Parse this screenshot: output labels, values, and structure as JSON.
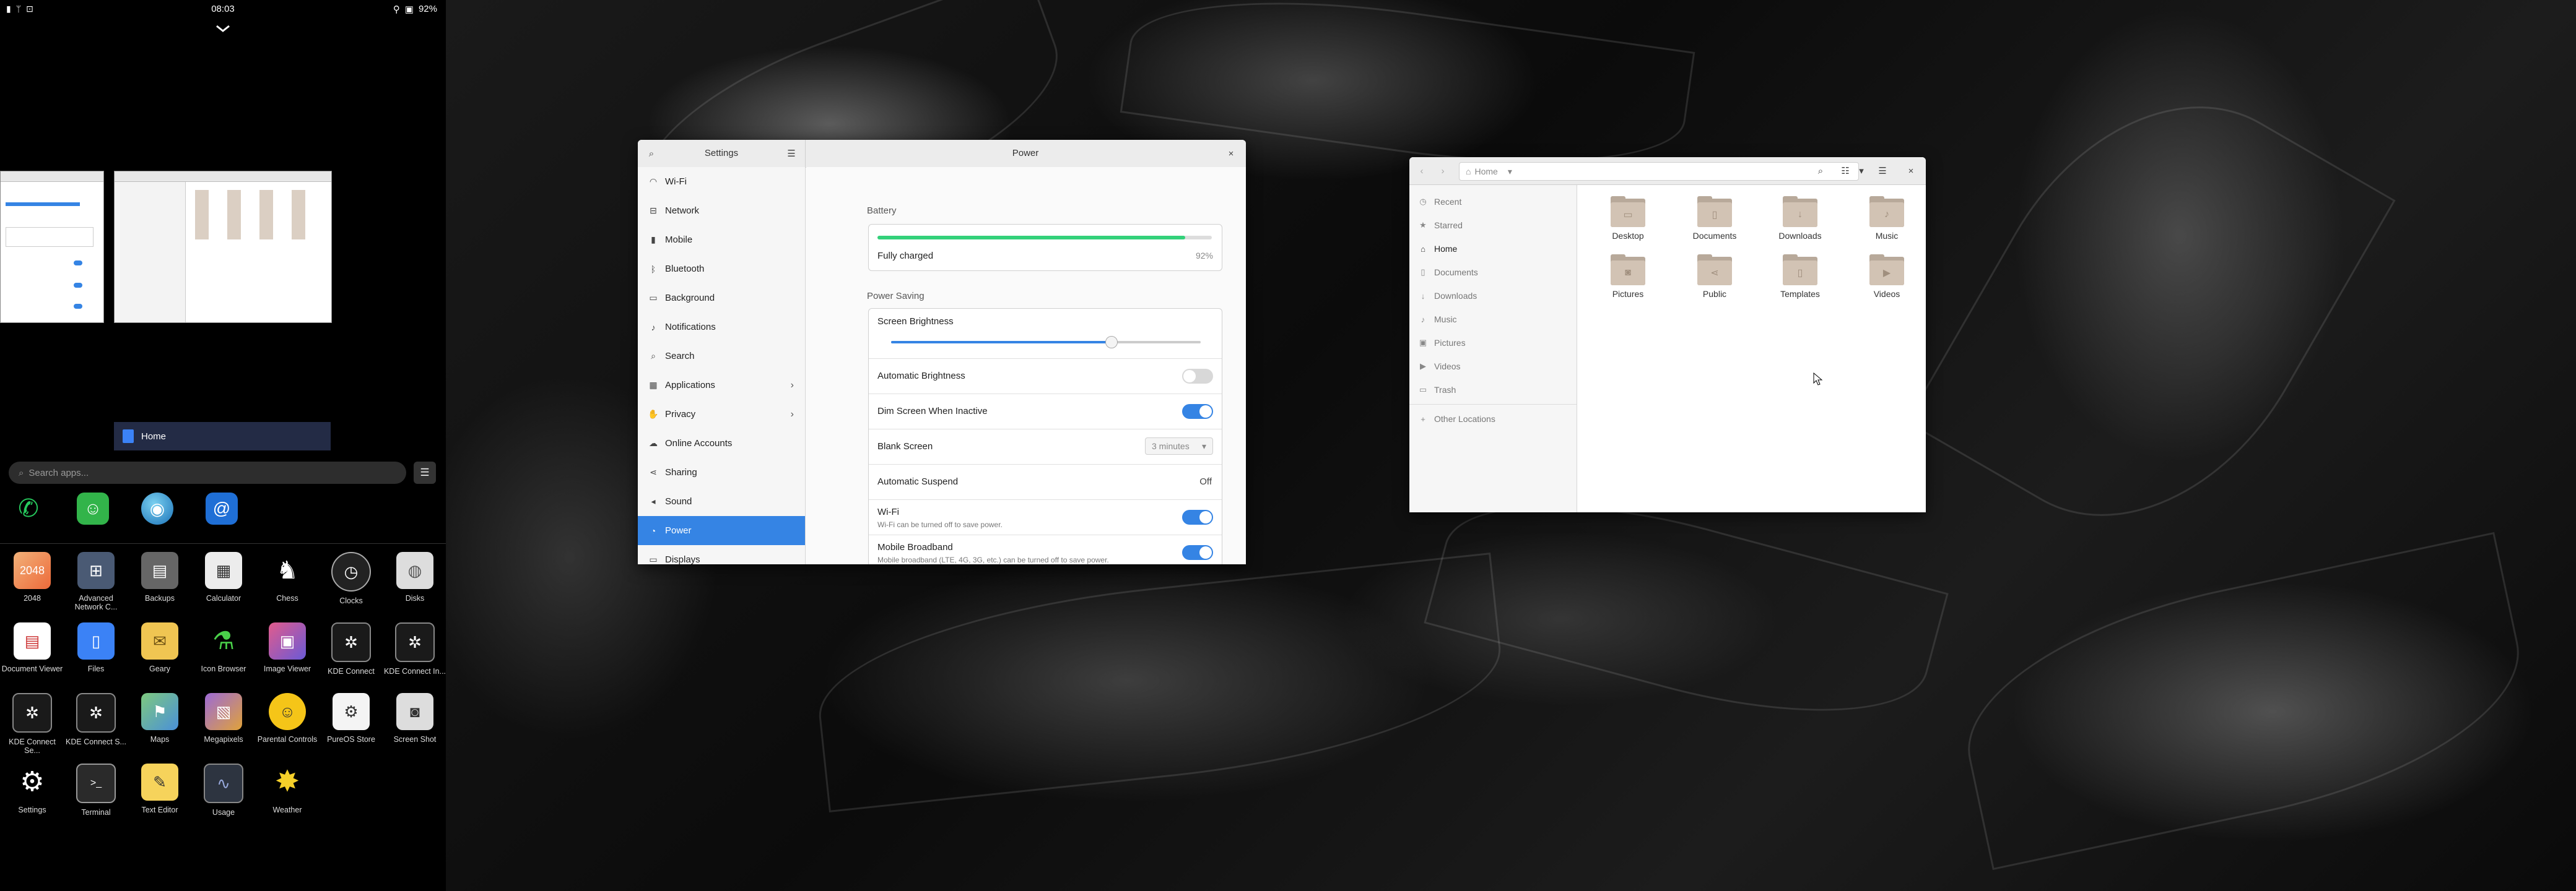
{
  "statusbar": {
    "time": "08:03",
    "battery": "92%"
  },
  "overview": {
    "active_window_title": "Home"
  },
  "app_search": {
    "placeholder": "Search apps..."
  },
  "apps": [
    {
      "label": "2048"
    },
    {
      "label": "Advanced Network C..."
    },
    {
      "label": "Backups"
    },
    {
      "label": "Calculator"
    },
    {
      "label": "Chess"
    },
    {
      "label": "Clocks"
    },
    {
      "label": "Disks"
    },
    {
      "label": "Document Viewer"
    },
    {
      "label": "Files"
    },
    {
      "label": "Geary"
    },
    {
      "label": "Icon Browser"
    },
    {
      "label": "Image Viewer"
    },
    {
      "label": "KDE Connect"
    },
    {
      "label": "KDE Connect In..."
    },
    {
      "label": "KDE Connect Se..."
    },
    {
      "label": "KDE Connect S..."
    },
    {
      "label": "Maps"
    },
    {
      "label": "Megapixels"
    },
    {
      "label": "Parental Controls"
    },
    {
      "label": "PureOS Store"
    },
    {
      "label": "Screen Shot"
    },
    {
      "label": "Settings"
    },
    {
      "label": "Terminal"
    },
    {
      "label": "Text Editor"
    },
    {
      "label": "Usage"
    },
    {
      "label": "Weather"
    }
  ],
  "settings": {
    "title": "Settings",
    "panel_title": "Power",
    "sidebar": [
      {
        "label": "Wi-Fi",
        "icon": "wifi-icon"
      },
      {
        "label": "Network",
        "icon": "network-icon"
      },
      {
        "label": "Mobile",
        "icon": "mobile-icon"
      },
      {
        "label": "Bluetooth",
        "icon": "bluetooth-icon"
      },
      {
        "label": "Background",
        "icon": "background-icon"
      },
      {
        "label": "Notifications",
        "icon": "bell-icon"
      },
      {
        "label": "Search",
        "icon": "search-icon"
      },
      {
        "label": "Applications",
        "icon": "apps-icon"
      },
      {
        "label": "Privacy",
        "icon": "hand-icon"
      },
      {
        "label": "Online Accounts",
        "icon": "cloud-icon"
      },
      {
        "label": "Sharing",
        "icon": "share-icon"
      },
      {
        "label": "Sound",
        "icon": "speaker-icon"
      },
      {
        "label": "Power",
        "icon": "power-icon"
      },
      {
        "label": "Displays",
        "icon": "display-icon"
      }
    ],
    "battery": {
      "section": "Battery",
      "status": "Fully charged",
      "percent": "92%",
      "level": 0.92
    },
    "power_saving": {
      "section": "Power Saving",
      "screen_brightness": "Screen Brightness",
      "brightness_level": 0.71,
      "automatic_brightness": "Automatic Brightness",
      "dim_screen": "Dim Screen When Inactive",
      "blank_screen": "Blank Screen",
      "blank_screen_value": "3 minutes",
      "automatic_suspend": "Automatic Suspend",
      "automatic_suspend_value": "Off",
      "wifi": "Wi-Fi",
      "wifi_sub": "Wi-Fi can be turned off to save power.",
      "mobile_broadband": "Mobile Broadband",
      "mobile_broadband_sub": "Mobile broadband (LTE, 4G, 3G, etc.) can be turned off to save power."
    }
  },
  "files": {
    "path": "Home",
    "sidebar": [
      {
        "label": "Recent",
        "icon": "clock-icon"
      },
      {
        "label": "Starred",
        "icon": "star-icon"
      },
      {
        "label": "Home",
        "icon": "home-icon"
      },
      {
        "label": "Documents",
        "icon": "document-icon"
      },
      {
        "label": "Downloads",
        "icon": "download-icon"
      },
      {
        "label": "Music",
        "icon": "music-icon"
      },
      {
        "label": "Pictures",
        "icon": "picture-icon"
      },
      {
        "label": "Videos",
        "icon": "video-icon"
      },
      {
        "label": "Trash",
        "icon": "trash-icon"
      },
      {
        "label": "Other Locations",
        "icon": "plus-icon"
      }
    ],
    "folders": [
      {
        "label": "Desktop"
      },
      {
        "label": "Documents"
      },
      {
        "label": "Downloads"
      },
      {
        "label": "Music"
      },
      {
        "label": "Pictures"
      },
      {
        "label": "Public"
      },
      {
        "label": "Templates"
      },
      {
        "label": "Videos"
      }
    ]
  }
}
